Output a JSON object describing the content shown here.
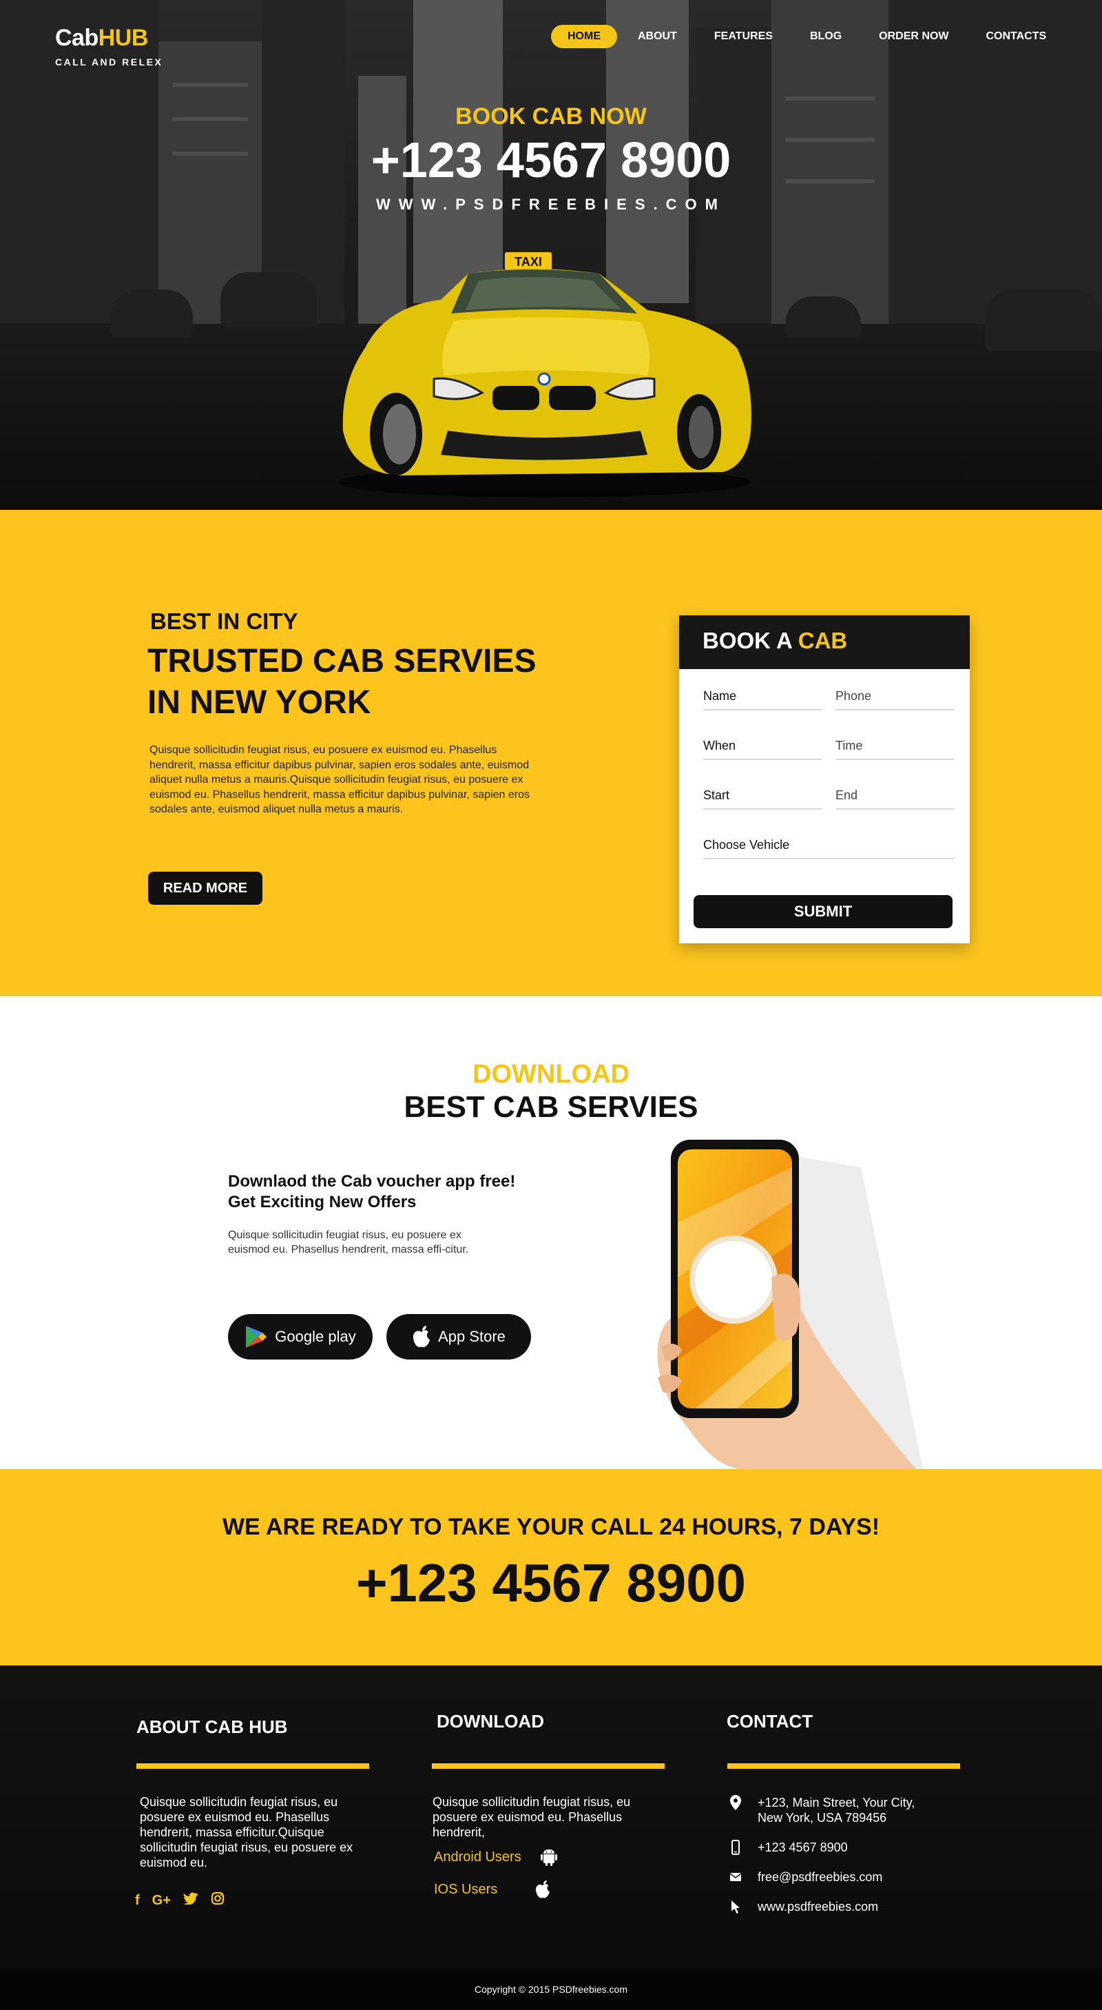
{
  "header": {
    "logo_part1": "Cab",
    "logo_part2": "HUB",
    "tagline": "CALL AND RELEX",
    "nav": [
      {
        "label": "HOME"
      },
      {
        "label": "ABOUT"
      },
      {
        "label": "FEATURES"
      },
      {
        "label": "BLOG"
      },
      {
        "label": "ORDER NOW"
      },
      {
        "label": "CONTACTS"
      }
    ],
    "active_nav": "HOME"
  },
  "hero": {
    "label": "BOOK CAB NOW",
    "phone": "+123 4567 8900",
    "url": "WWW.PSDFREEBIES.COM",
    "taxi_sign": "TAXI"
  },
  "booking": {
    "kicker": "BEST IN CITY",
    "title_line1": "TRUSTED CAB SERVIES",
    "title_line2": "IN NEW YORK",
    "text": "Quisque sollicitudin feugiat risus, eu posuere ex euismod eu. Phasellus hendrerit, massa efficitur dapibus pulvinar, sapien eros sodales ante, euismod aliquet nulla metus a mauris.Quisque sollicitudin feugiat risus, eu posuere ex euismod eu. Phasellus hendrerit, massa efficitur dapibus pulvinar, sapien eros sodales ante, euismod aliquet nulla metus a mauris.",
    "read_more": "READ MORE",
    "form": {
      "title_part1": "BOOK A",
      "title_part2": "CAB",
      "name_placeholder": "Name",
      "phone_placeholder": "Phone",
      "when_placeholder": "When",
      "time_placeholder": "Time",
      "start_placeholder": "Start",
      "end_placeholder": "End",
      "vehicle_placeholder": "Choose Vehicle",
      "submit": "SUBMIT"
    }
  },
  "download": {
    "kicker": "DOWNLOAD",
    "title": "BEST CAB SERVIES",
    "sub_line1": "Downlaod the Cab voucher app free!",
    "sub_line2": "Get Exciting New Offers",
    "text": "Quisque sollicitudin feugiat risus, eu posuere ex euismod eu. Phasellus hendrerit, massa effi-citur.",
    "google_play": "Google play",
    "app_store": "App Store"
  },
  "call": {
    "line": "WE ARE READY TO TAKE YOUR CALL 24 HOURS, 7 DAYS!",
    "phone": "+123 4567 8900"
  },
  "footer": {
    "about_title": "ABOUT CAB HUB",
    "about_text": "Quisque sollicitudin feugiat risus, eu posuere ex euismod eu. Phasellus hendrerit, massa efficitur.Quisque sollicitudin feugiat risus, eu posuere ex euismod eu.",
    "socials": [
      "f",
      "G+",
      "t",
      "ig"
    ],
    "download_title": "DOWNLOAD",
    "download_text": "Quisque sollicitudin feugiat risus, eu posuere ex euismod eu. Phasellus hendrerit,",
    "android": "Android Users",
    "ios": "IOS Users",
    "contact_title": "CONTACT",
    "address_line1": "+123, Main Street, Your City,",
    "address_line2": "New York, USA 789456",
    "phone": "+123 4567 8900",
    "email": "free@psdfreebies.com",
    "website": "www.psdfreebies.com",
    "copyright": "Copyright © 2015 PSDfreebies.com"
  },
  "colors": {
    "accent": "#fcc41d",
    "dark": "#111111",
    "footer_bg": "#0e0e0e"
  }
}
